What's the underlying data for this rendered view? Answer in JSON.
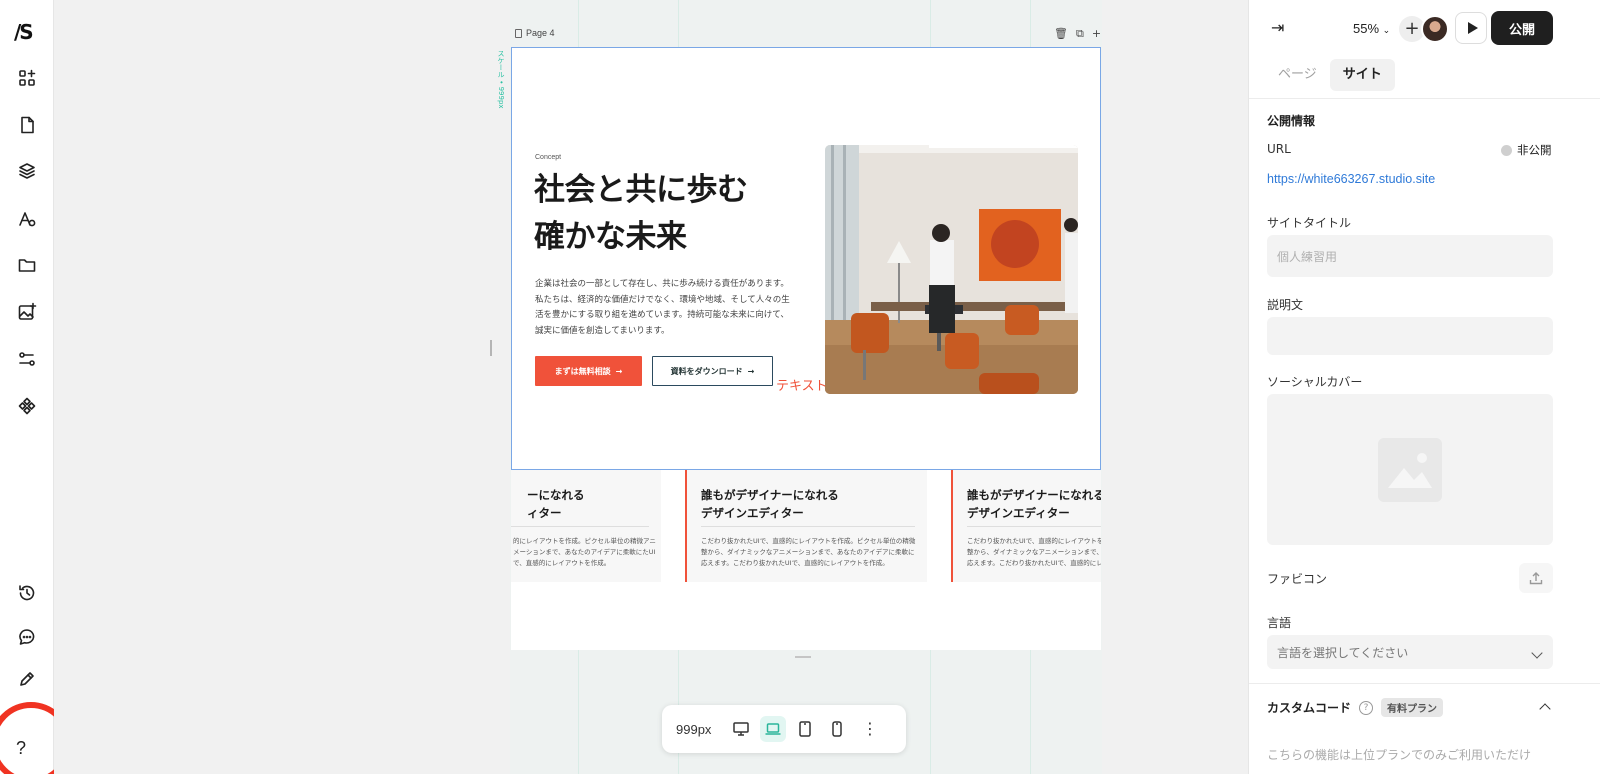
{
  "left_sidebar": {
    "logo": "/S",
    "icons": [
      "add-section-icon",
      "page-icon",
      "layers-icon",
      "font-style-icon",
      "folder-icon",
      "add-image-icon",
      "cms-icon",
      "components-icon"
    ],
    "bottom_icons": [
      "history-icon",
      "comment-icon",
      "pencil-icon"
    ],
    "help_label": "?"
  },
  "canvas": {
    "page_label": "Page 4",
    "scale_tag": "スケール • 999px",
    "hero": {
      "eyebrow": "Concept",
      "title_line1": "社会と共に歩む",
      "title_line2": "確かな未来",
      "body": "企業は社会の一部として存在し、共に歩み続ける責任があります。私たちは、経済的な価値だけでなく、環境や地域、そして人々の生活を豊かにする取り組を進めています。持続可能な未来に向けて、誠実に価値を創造してまいります。",
      "primary_button": "まずは無料相談",
      "secondary_button": "資料をダウンロード",
      "arrow": "→",
      "floating_text": "テキスト"
    },
    "cards": [
      {
        "title_line1": "ーになれる",
        "title_line2": "ィター",
        "body": "的にレイアウトを作成。ピクセル単位の精微アニメーションまで、あなたのアイデアに柔軟にたUIで、直感的にレイアウトを作成。"
      },
      {
        "title_line1": "誰もがデザイナーになれる",
        "title_line2": "デザインエディター",
        "body": "こだわり抜かれたUIで、直感的にレイアウトを作成。ピクセル単位の精微整から、ダイナミックなアニメーションまで、あなたのアイデアに柔軟に応えます。こだわり抜かれたUIで、直感的にレイアウトを作成。"
      },
      {
        "title_line1": "誰もがデザイナーになれる",
        "title_line2": "デザインエディター",
        "body": "こだわり抜かれたUIで、直感的にレイアウトを作成。ピクセル単位の精微整から、ダイナミックなアニメーションまで、あなたのアイデアに柔軟に応えます。こだわり抜かれたUIで、直感的にレイアウトを作成。"
      }
    ],
    "toolbar": {
      "width_value": "999px",
      "devices": [
        "desktop-icon",
        "laptop-icon",
        "tablet-icon",
        "mobile-icon"
      ],
      "active_device": "laptop-icon",
      "more": "⋮"
    }
  },
  "right_panel": {
    "zoom": "55%",
    "publish_button": "公開",
    "tabs": [
      "ページ",
      "サイト"
    ],
    "active_tab": "サイト",
    "publish_info_title": "公開情報",
    "url_label": "URL",
    "status": "非公開",
    "url": "https://white663267.studio.site",
    "site_title_label": "サイトタイトル",
    "site_title_placeholder": "個人練習用",
    "description_label": "説明文",
    "description_value": "",
    "social_cover_label": "ソーシャルカバー",
    "favicon_label": "ファビコン",
    "language_label": "言語",
    "language_placeholder": "言語を選択してください",
    "custom_code_title": "カスタムコード",
    "paid_plan_badge": "有料プラン",
    "custom_code_note": "こちらの機能は上位プランでのみご利用いただけ"
  },
  "colors": {
    "accent": "#f0523a",
    "link": "#2f7ad8",
    "selection": "#7aa7e6",
    "annotation": "#f03322",
    "guide": "#2bc1a3"
  }
}
